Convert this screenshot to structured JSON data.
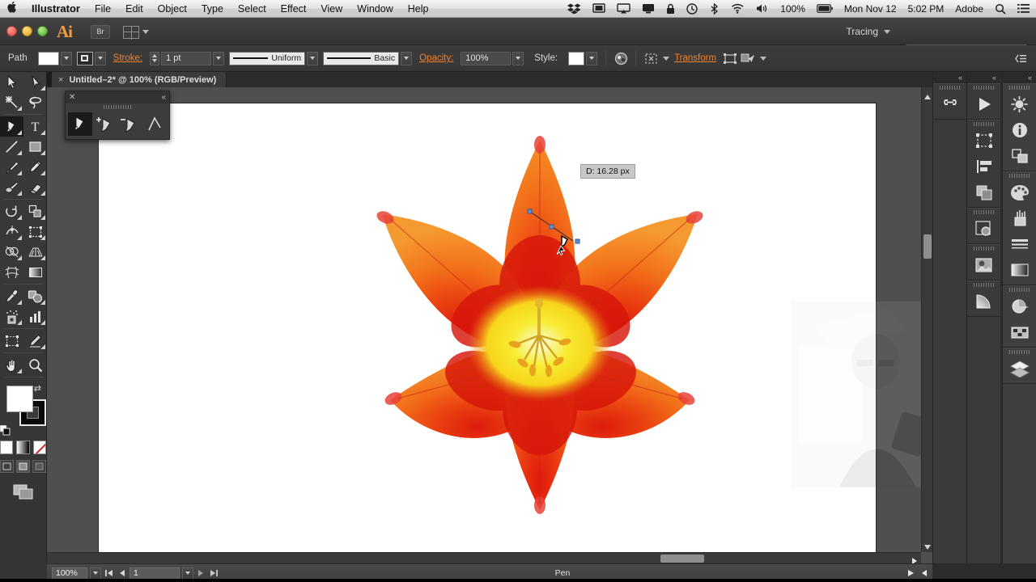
{
  "macbar": {
    "apple_icon": "apple-icon",
    "app_name": "Illustrator",
    "menus": [
      "File",
      "Edit",
      "Object",
      "Type",
      "Select",
      "Effect",
      "View",
      "Window",
      "Help"
    ],
    "status_icons": [
      "dropbox-icon",
      "display-icon",
      "airplay-icon",
      "screen-share-icon",
      "lock-icon",
      "time-machine-icon",
      "bluetooth-icon",
      "wifi-icon",
      "volume-icon"
    ],
    "battery_percent": "100%",
    "date": "Mon Nov 12",
    "time": "5:02 PM",
    "user": "Adobe",
    "search_icon": "search-icon",
    "menu_icon": "notification-center-icon"
  },
  "appbar": {
    "logo": "Ai",
    "bridge_label": "Br",
    "arrange_icon": "arrange-documents-icon",
    "workspace": "Tracing",
    "search_placeholder": ""
  },
  "control_bar": {
    "selection_label": "Path",
    "fill_label": "fill-swatch",
    "stroke_swatch_label": "stroke-swatch",
    "stroke_label": "Stroke:",
    "stroke_weight": "1 pt",
    "variable_width_profile": "Uniform",
    "brush_definition": "Basic",
    "opacity_label": "Opacity:",
    "opacity_value": "100%",
    "style_label": "Style:",
    "recolor_icon": "recolor-artwork-icon",
    "isolate_icon": "isolate-group-icon",
    "transform_label": "Transform",
    "align_icon": "align-icon",
    "drawing_modes_icon": "draw-mode-icon",
    "panel_menu_icon": "panel-menu-icon"
  },
  "document_tab": {
    "close_icon": "close-icon",
    "title": "Untitled–2* @ 100% (RGB/Preview)"
  },
  "tools_panel": {
    "items": [
      {
        "name": "selection-tool",
        "glyph": "selection-arrow",
        "selected": false
      },
      {
        "name": "direct-selection-tool",
        "glyph": "direct-arrow",
        "selected": false
      },
      {
        "name": "magic-wand-tool",
        "glyph": "magic-wand",
        "selected": false
      },
      {
        "name": "lasso-tool",
        "glyph": "lasso",
        "selected": false
      },
      {
        "name": "pen-tool",
        "glyph": "pen",
        "selected": true
      },
      {
        "name": "type-tool",
        "glyph": "T",
        "selected": false
      },
      {
        "name": "line-segment-tool",
        "glyph": "line",
        "selected": false
      },
      {
        "name": "rectangle-tool",
        "glyph": "rectangle",
        "selected": false
      },
      {
        "name": "paintbrush-tool",
        "glyph": "brush",
        "selected": false
      },
      {
        "name": "pencil-tool",
        "glyph": "pencil",
        "selected": false
      },
      {
        "name": "blob-brush-tool",
        "glyph": "blob-brush",
        "selected": false
      },
      {
        "name": "eraser-tool",
        "glyph": "eraser",
        "selected": false
      },
      {
        "name": "rotate-tool",
        "glyph": "rotate",
        "selected": false
      },
      {
        "name": "scale-tool",
        "glyph": "scale",
        "selected": false
      },
      {
        "name": "width-tool",
        "glyph": "width",
        "selected": false
      },
      {
        "name": "free-transform-tool",
        "glyph": "free-transform",
        "selected": false
      },
      {
        "name": "shape-builder-tool",
        "glyph": "shape-builder",
        "selected": false
      },
      {
        "name": "perspective-grid-tool",
        "glyph": "perspective",
        "selected": false
      },
      {
        "name": "mesh-tool",
        "glyph": "mesh",
        "selected": false
      },
      {
        "name": "gradient-tool",
        "glyph": "gradient",
        "selected": false
      },
      {
        "name": "eyedropper-tool",
        "glyph": "eyedropper",
        "selected": false
      },
      {
        "name": "blend-tool",
        "glyph": "blend",
        "selected": false
      },
      {
        "name": "symbol-sprayer-tool",
        "glyph": "symbol-sprayer",
        "selected": false
      },
      {
        "name": "column-graph-tool",
        "glyph": "bar-graph",
        "selected": false
      },
      {
        "name": "artboard-tool",
        "glyph": "artboard",
        "selected": false
      },
      {
        "name": "slice-tool",
        "glyph": "slice",
        "selected": false
      },
      {
        "name": "hand-tool",
        "glyph": "hand",
        "selected": false
      },
      {
        "name": "zoom-tool",
        "glyph": "magnifier",
        "selected": false
      }
    ],
    "fill_color": "#ffffff",
    "stroke_color": "#000000",
    "color_modes": [
      "color-swatch",
      "gradient-swatch",
      "none-swatch"
    ],
    "screen_modes": [
      "normal-screen-mode",
      "full-screen-with-menu",
      "full-screen-mode"
    ]
  },
  "pen_panel": {
    "close_icon": "close-icon",
    "collapse_icon": "collapse-icon",
    "tools": [
      {
        "name": "pen-tool",
        "selected": true
      },
      {
        "name": "add-anchor-point-tool",
        "selected": false
      },
      {
        "name": "delete-anchor-point-tool",
        "selected": false
      },
      {
        "name": "convert-anchor-point-tool",
        "selected": false
      }
    ]
  },
  "canvas": {
    "artwork_name": "orange-lily-flower",
    "artwork_colors": {
      "petal_outer": "#f4821f",
      "petal_mid": "#ef5a18",
      "petal_inner_red": "#dd1f12",
      "center_yellow": "#f4e71a",
      "center_white": "#fdfce4",
      "tip_red": "#e8433a"
    },
    "ghost_overlay": "webcam-reflection-overlay",
    "measurement_tooltip": "D: 16.28 px",
    "path_anchor_color": "#3a7fd5",
    "cursor": "pen-cursor"
  },
  "right_dock": {
    "collapse_icons": [
      "collapse-panel-icon",
      "collapse-panel-icon",
      "collapse-panel-icon"
    ],
    "column1": [
      {
        "name": "links-panel-icon"
      }
    ],
    "column2": [
      {
        "name": "actions-panel-icon"
      },
      {
        "name": "transform-panel-icon"
      },
      {
        "name": "align-panel-icon"
      },
      {
        "name": "pathfinder-panel-icon"
      },
      {
        "name": "transparency-panel-icon"
      },
      {
        "name": "image-trace-panel-icon"
      },
      {
        "name": "gradient-mesh-panel-icon"
      }
    ],
    "column3": [
      {
        "name": "appearance-panel-icon"
      },
      {
        "name": "info-panel-icon"
      },
      {
        "name": "graphic-styles-panel-icon"
      },
      {
        "name": "color-panel-icon"
      },
      {
        "name": "brushes-panel-icon"
      },
      {
        "name": "stroke-panel-icon"
      },
      {
        "name": "gradient-panel-icon"
      },
      {
        "name": "color-guide-panel-icon"
      },
      {
        "name": "swatches-panel-icon"
      },
      {
        "name": "layers-panel-icon"
      }
    ]
  },
  "status_bar": {
    "zoom_level": "100%",
    "first_page_icon": "first-artboard-icon",
    "prev_page_icon": "prev-artboard-icon",
    "artboard_number": "1",
    "next_page_icon": "next-artboard-icon",
    "last_page_icon": "last-artboard-icon",
    "current_tool": "Pen",
    "play_icon": "play-icon",
    "collapse_icon": "collapse-icon"
  }
}
